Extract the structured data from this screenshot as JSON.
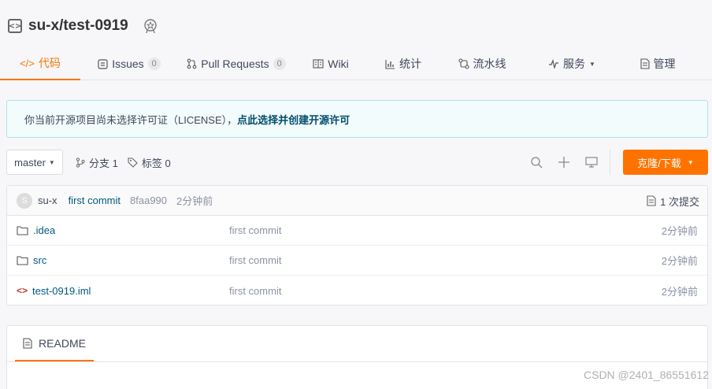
{
  "repo": {
    "title": "su-x/test-0919"
  },
  "tabs": [
    {
      "label": "代码",
      "icon": "code-icon"
    },
    {
      "label": "Issues",
      "count": "0",
      "icon": "issues-icon"
    },
    {
      "label": "Pull Requests",
      "count": "0",
      "icon": "pull-request-icon"
    },
    {
      "label": "Wiki",
      "icon": "wiki-icon"
    },
    {
      "label": "统计",
      "icon": "chart-icon"
    },
    {
      "label": "流水线",
      "icon": "pipeline-icon"
    },
    {
      "label": "服务",
      "icon": "service-icon"
    },
    {
      "label": "管理",
      "icon": "settings-icon"
    }
  ],
  "notice": {
    "text": "你当前开源项目尚未选择许可证（LICENSE），",
    "link": "点此选择并创建开源许可"
  },
  "toolbar": {
    "branch": "master",
    "branches": "分支 1",
    "tags": "标签 0",
    "clone_label": "克隆/下载"
  },
  "commit": {
    "avatar_letter": "S",
    "user": "su-x",
    "message": "first commit",
    "sha": "8faa990",
    "time": "2分钟前",
    "commit_count": "1 次提交"
  },
  "files": [
    {
      "name": ".idea",
      "type": "folder",
      "message": "first commit",
      "time": "2分钟前"
    },
    {
      "name": "src",
      "type": "folder",
      "message": "first commit",
      "time": "2分钟前"
    },
    {
      "name": "test-0919.iml",
      "type": "code",
      "message": "first commit",
      "time": "2分钟前"
    }
  ],
  "readme": {
    "label": "README"
  },
  "watermark": "CSDN @2401_86551612",
  "colors": {
    "accent": "#fe7300",
    "link": "#005980",
    "notice_bg": "#f2fcfc"
  }
}
